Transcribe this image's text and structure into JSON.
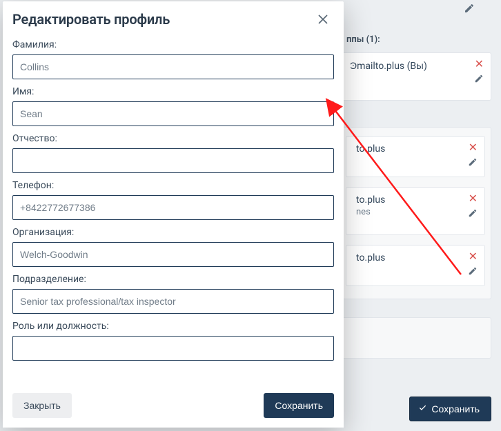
{
  "modal": {
    "title": "Редактировать профиль",
    "fields": {
      "lastname": {
        "label": "Фамилия:",
        "value": "Collins"
      },
      "firstname": {
        "label": "Имя:",
        "value": "Sean"
      },
      "patronymic": {
        "label": "Отчество:",
        "value": ""
      },
      "phone": {
        "label": "Телефон:",
        "value": "+8422772677386"
      },
      "org": {
        "label": "Организация:",
        "value": "Welch-Goodwin"
      },
      "dept": {
        "label": "Подразделение:",
        "value": "Senior tax professional/tax inspector"
      },
      "role": {
        "label": "Роль или должность:",
        "value": ""
      }
    },
    "buttons": {
      "close": "Закрыть",
      "save": "Сохранить"
    }
  },
  "background": {
    "groups_heading": "ппы (1):",
    "card1": {
      "line1": "Ͽmailto.plus (Вы)"
    },
    "card2": {
      "line1": "to.plus"
    },
    "card3": {
      "line1": "to.plus",
      "line2": "nes"
    },
    "card4": {
      "line1": "to.plus"
    },
    "save_btn": "Сохранить"
  }
}
